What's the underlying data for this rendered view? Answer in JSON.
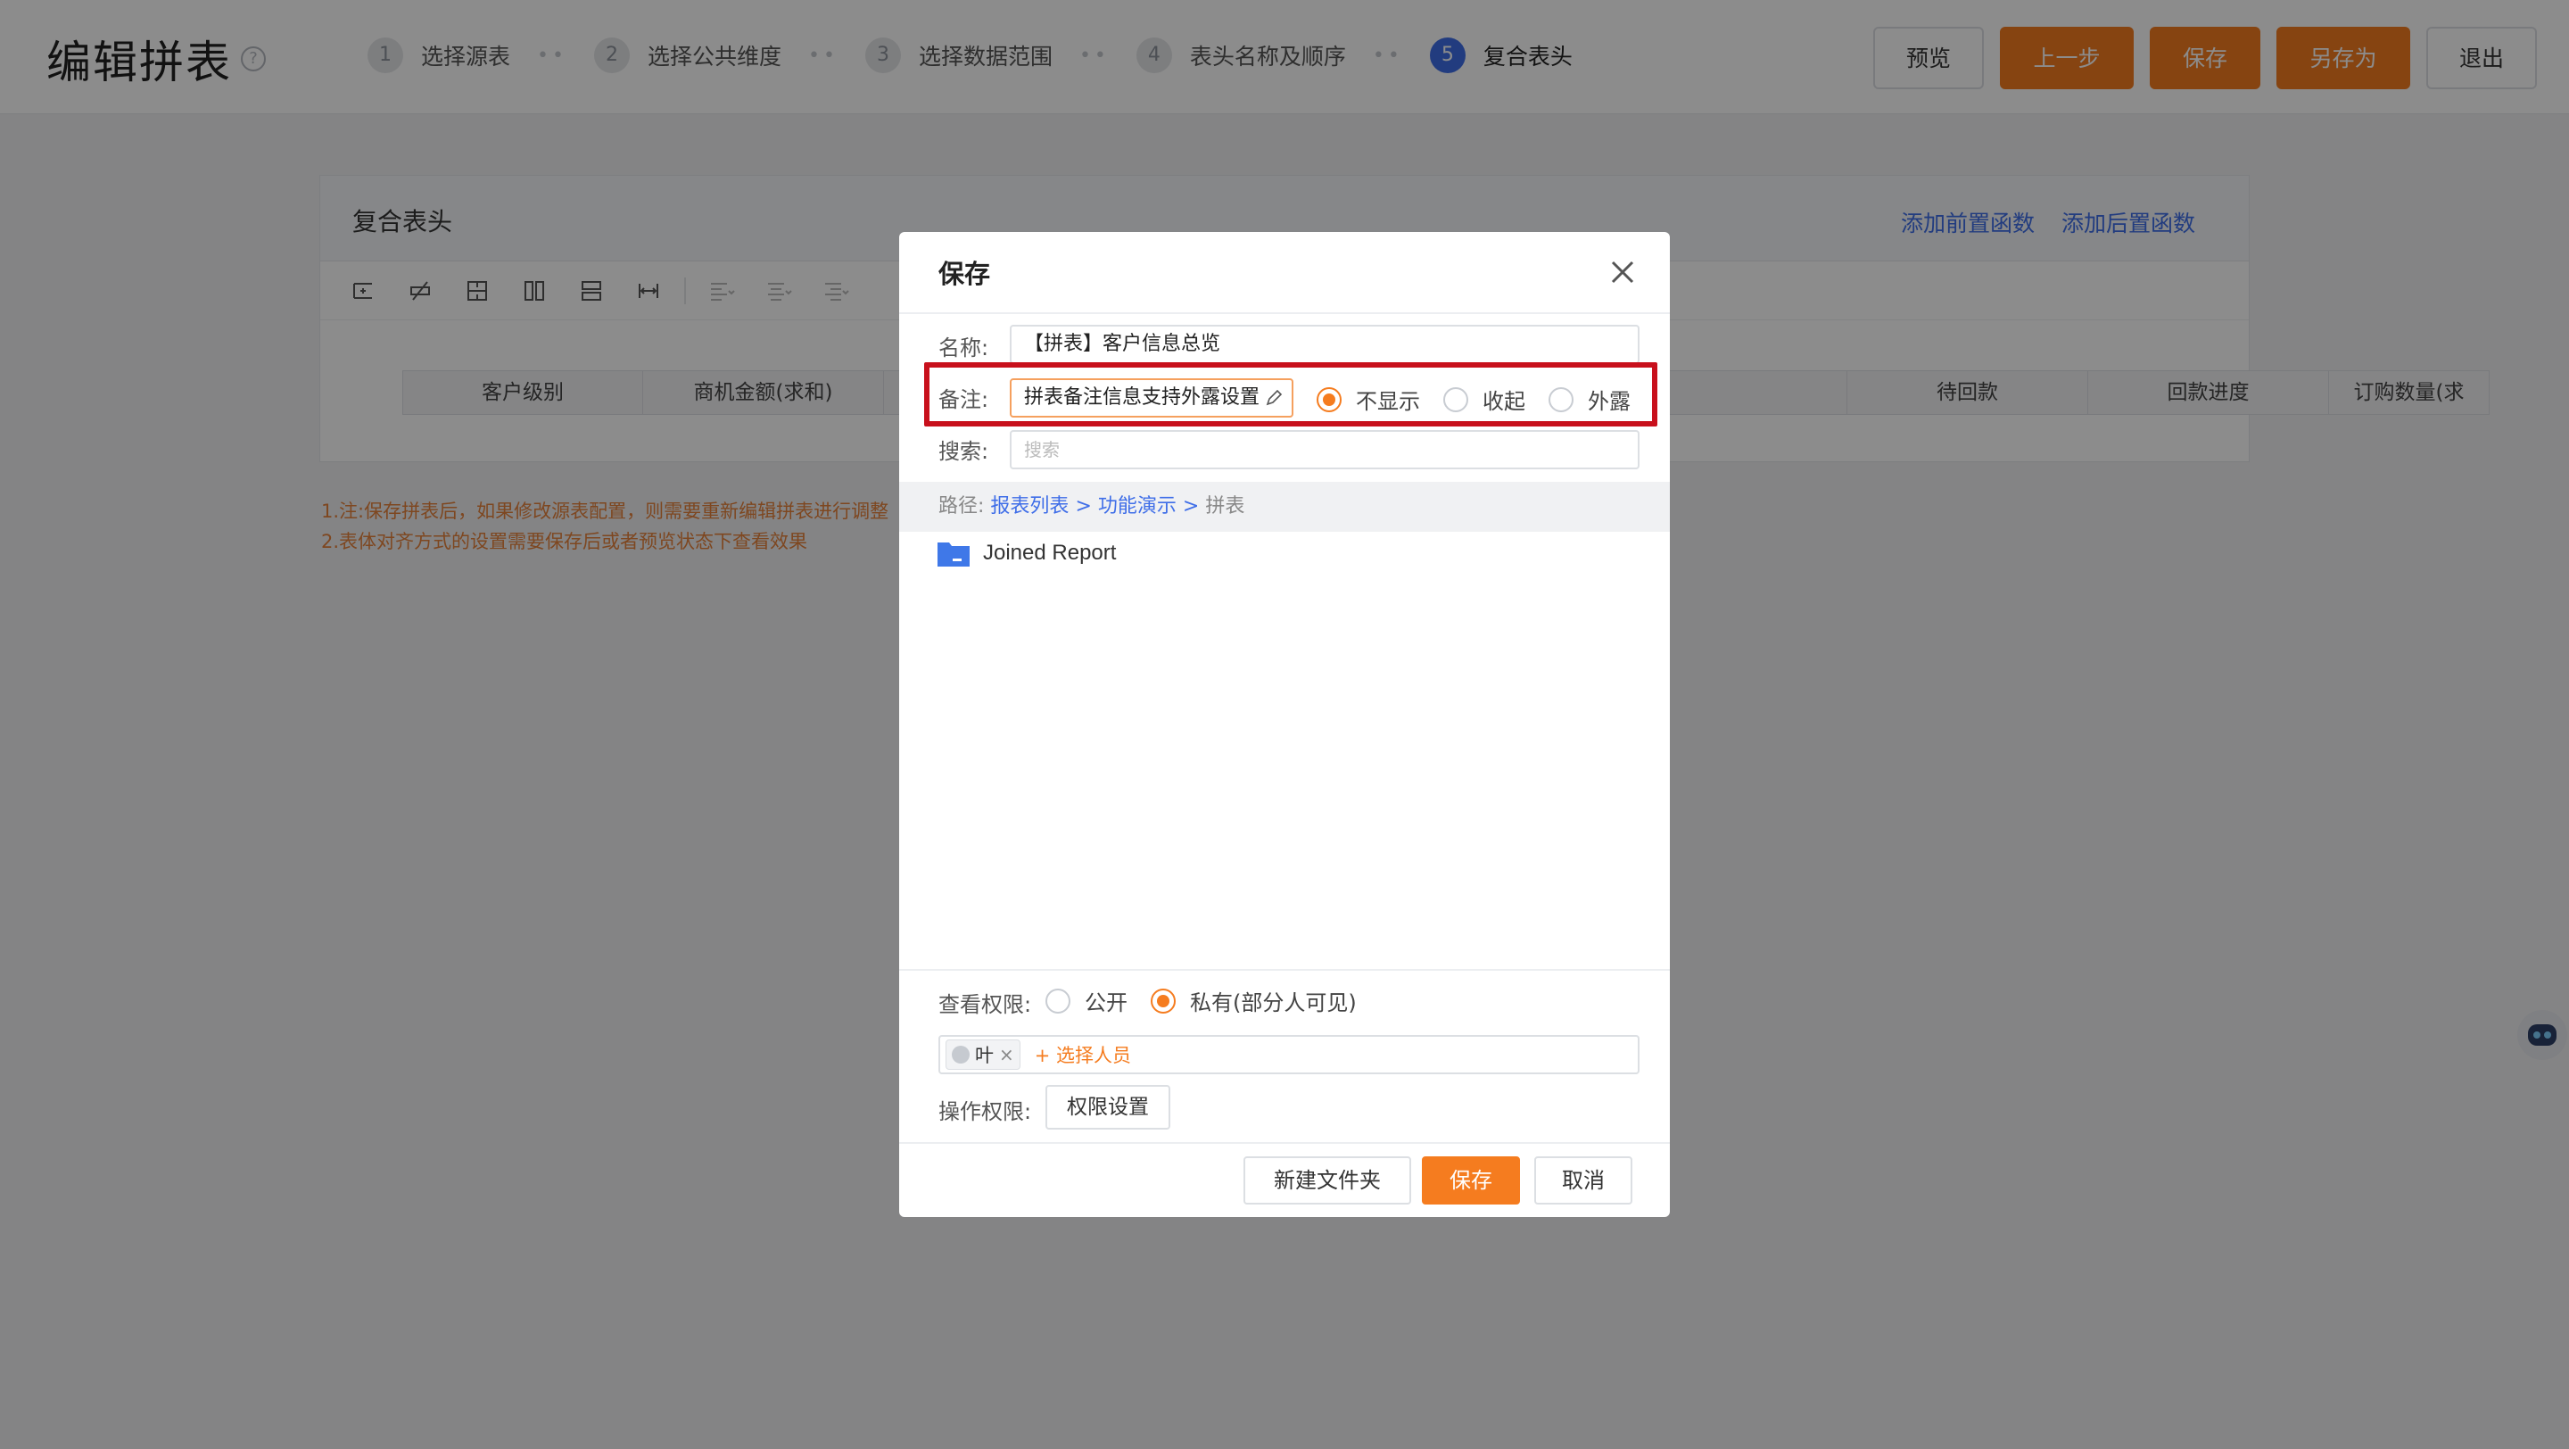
{
  "header": {
    "title": "编辑拼表",
    "help_icon": "question-circle-icon",
    "steps": [
      {
        "num": "1",
        "label": "选择源表"
      },
      {
        "num": "2",
        "label": "选择公共维度"
      },
      {
        "num": "3",
        "label": "选择数据范围"
      },
      {
        "num": "4",
        "label": "表头名称及顺序"
      },
      {
        "num": "5",
        "label": "复合表头",
        "active": true
      }
    ],
    "buttons": {
      "preview": "预览",
      "prev": "上一步",
      "save": "保存",
      "save_as": "另存为",
      "exit": "退出"
    }
  },
  "card": {
    "title": "复合表头",
    "add_pre_func": "添加前置函数",
    "add_post_func": "添加后置函数",
    "columns": [
      "客户级别",
      "商机金额(求和)",
      "",
      "",
      "",
      "",
      "待回款",
      "回款进度",
      "订购数量(求"
    ]
  },
  "notes": [
    "1.注:保存拼表后，如果修改源表配置，则需要重新编辑拼表进行调整",
    "2.表体对齐方式的设置需要保存后或者预览状态下查看效果"
  ],
  "modal": {
    "title": "保存",
    "name_label": "名称:",
    "name_value": "【拼表】客户信息总览",
    "remark_label": "备注:",
    "remark_value": "拼表备注信息支持外露设置",
    "remark_options": [
      {
        "label": "不显示",
        "checked": true
      },
      {
        "label": "收起",
        "checked": false
      },
      {
        "label": "外露",
        "checked": false
      }
    ],
    "search_label": "搜索:",
    "search_placeholder": "搜索",
    "path_label": "路径:",
    "path_items": [
      "报表列表",
      "功能演示",
      "拼表"
    ],
    "path_sep": ">",
    "folder_name": "Joined Report",
    "view_perm_label": "查看权限:",
    "view_perm_options": [
      {
        "label": "公开",
        "checked": false
      },
      {
        "label": "私有(部分人可见)",
        "checked": true
      }
    ],
    "person_tag": "叶",
    "add_person": "+ 选择人员",
    "op_perm_label": "操作权限:",
    "perm_button": "权限设置",
    "footer": {
      "new_folder": "新建文件夹",
      "save": "保存",
      "cancel": "取消"
    }
  },
  "colors": {
    "accent": "#f57c1f",
    "link": "#3f6ee8",
    "highlight": "#c8101c"
  }
}
